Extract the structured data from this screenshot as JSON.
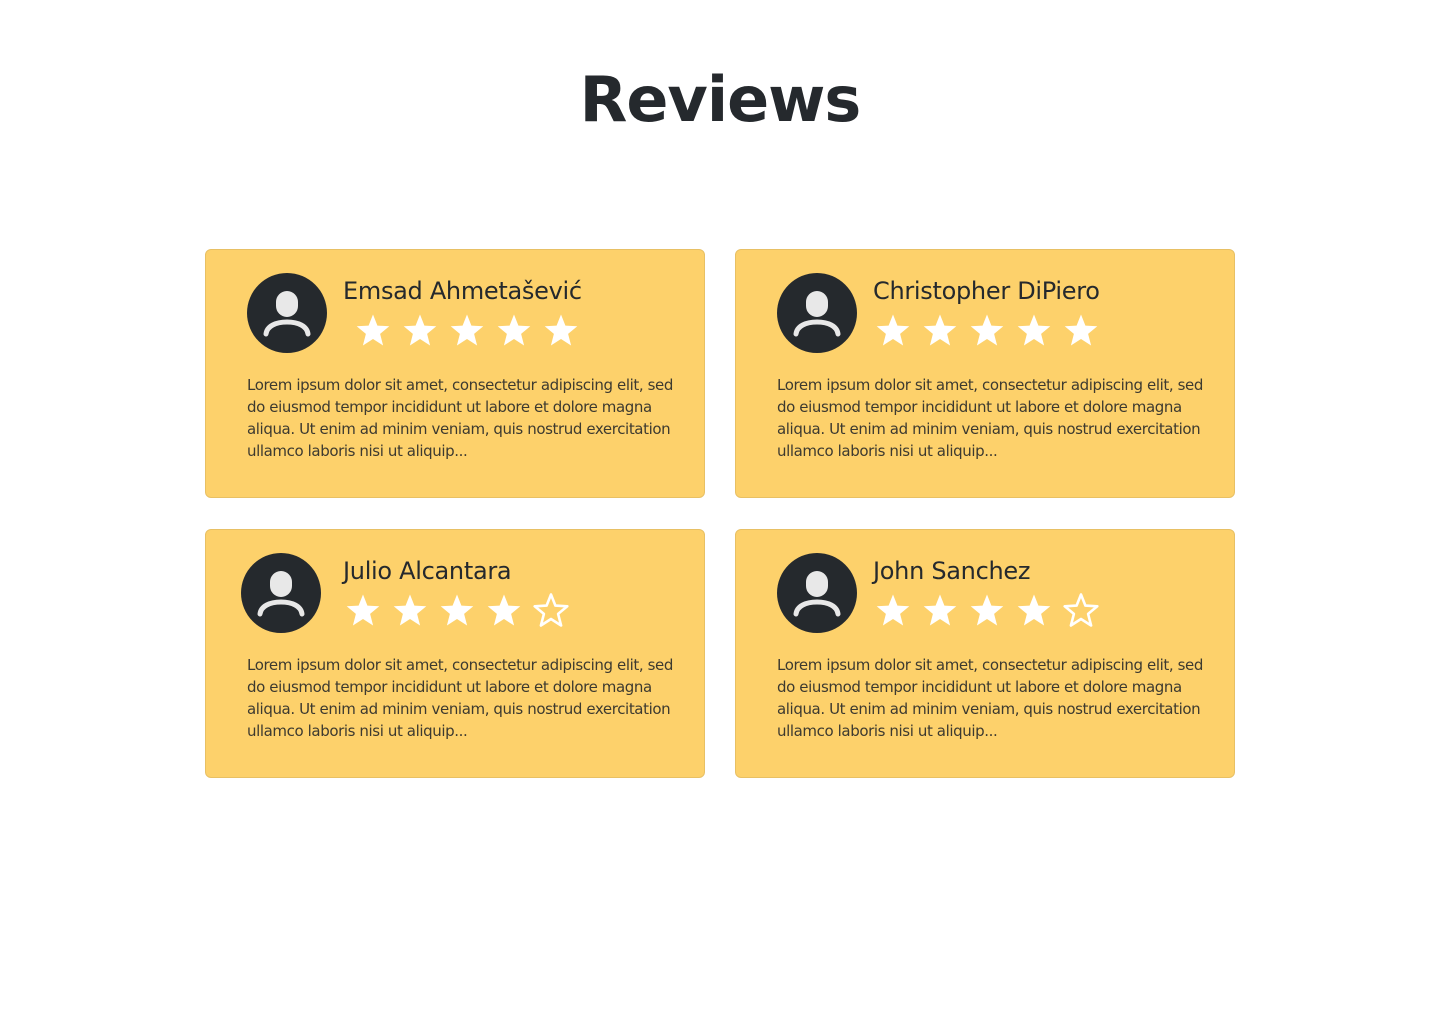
{
  "page": {
    "title": "Reviews"
  },
  "colors": {
    "card_background": "#fdd16b",
    "avatar_background": "#25292d",
    "star_color": "#ffffff",
    "title_color": "#25292d"
  },
  "reviews": [
    {
      "name": "Emsad Ahmetašević",
      "rating": 5,
      "max_rating": 5,
      "text": "Lorem ipsum dolor sit amet, consectetur adipiscing elit, sed do eiusmod tempor incididunt ut labore et dolore magna aliqua. Ut enim ad minim veniam, quis nostrud exercitation ullamco laboris nisi ut aliquip...",
      "avatar_icon": "user-avatar-icon"
    },
    {
      "name": "Christopher DiPiero",
      "rating": 5,
      "max_rating": 5,
      "text": "Lorem ipsum dolor sit amet, consectetur adipiscing elit, sed do eiusmod tempor incididunt ut labore et dolore magna aliqua. Ut enim ad minim veniam, quis nostrud exercitation ullamco laboris nisi ut aliquip...",
      "avatar_icon": "user-avatar-icon"
    },
    {
      "name": "Julio Alcantara",
      "rating": 4,
      "max_rating": 5,
      "text": "Lorem ipsum dolor sit amet, consectetur adipiscing elit, sed do eiusmod tempor incididunt ut labore et dolore magna aliqua. Ut enim ad minim veniam, quis nostrud exercitation ullamco laboris nisi ut aliquip...",
      "avatar_icon": "user-avatar-icon"
    },
    {
      "name": "John Sanchez",
      "rating": 4,
      "max_rating": 5,
      "text": "Lorem ipsum dolor sit amet, consectetur adipiscing elit, sed do eiusmod tempor incididunt ut labore et dolore magna aliqua. Ut enim ad minim veniam, quis nostrud exercitation ullamco laboris nisi ut aliquip...",
      "avatar_icon": "user-avatar-icon"
    }
  ]
}
